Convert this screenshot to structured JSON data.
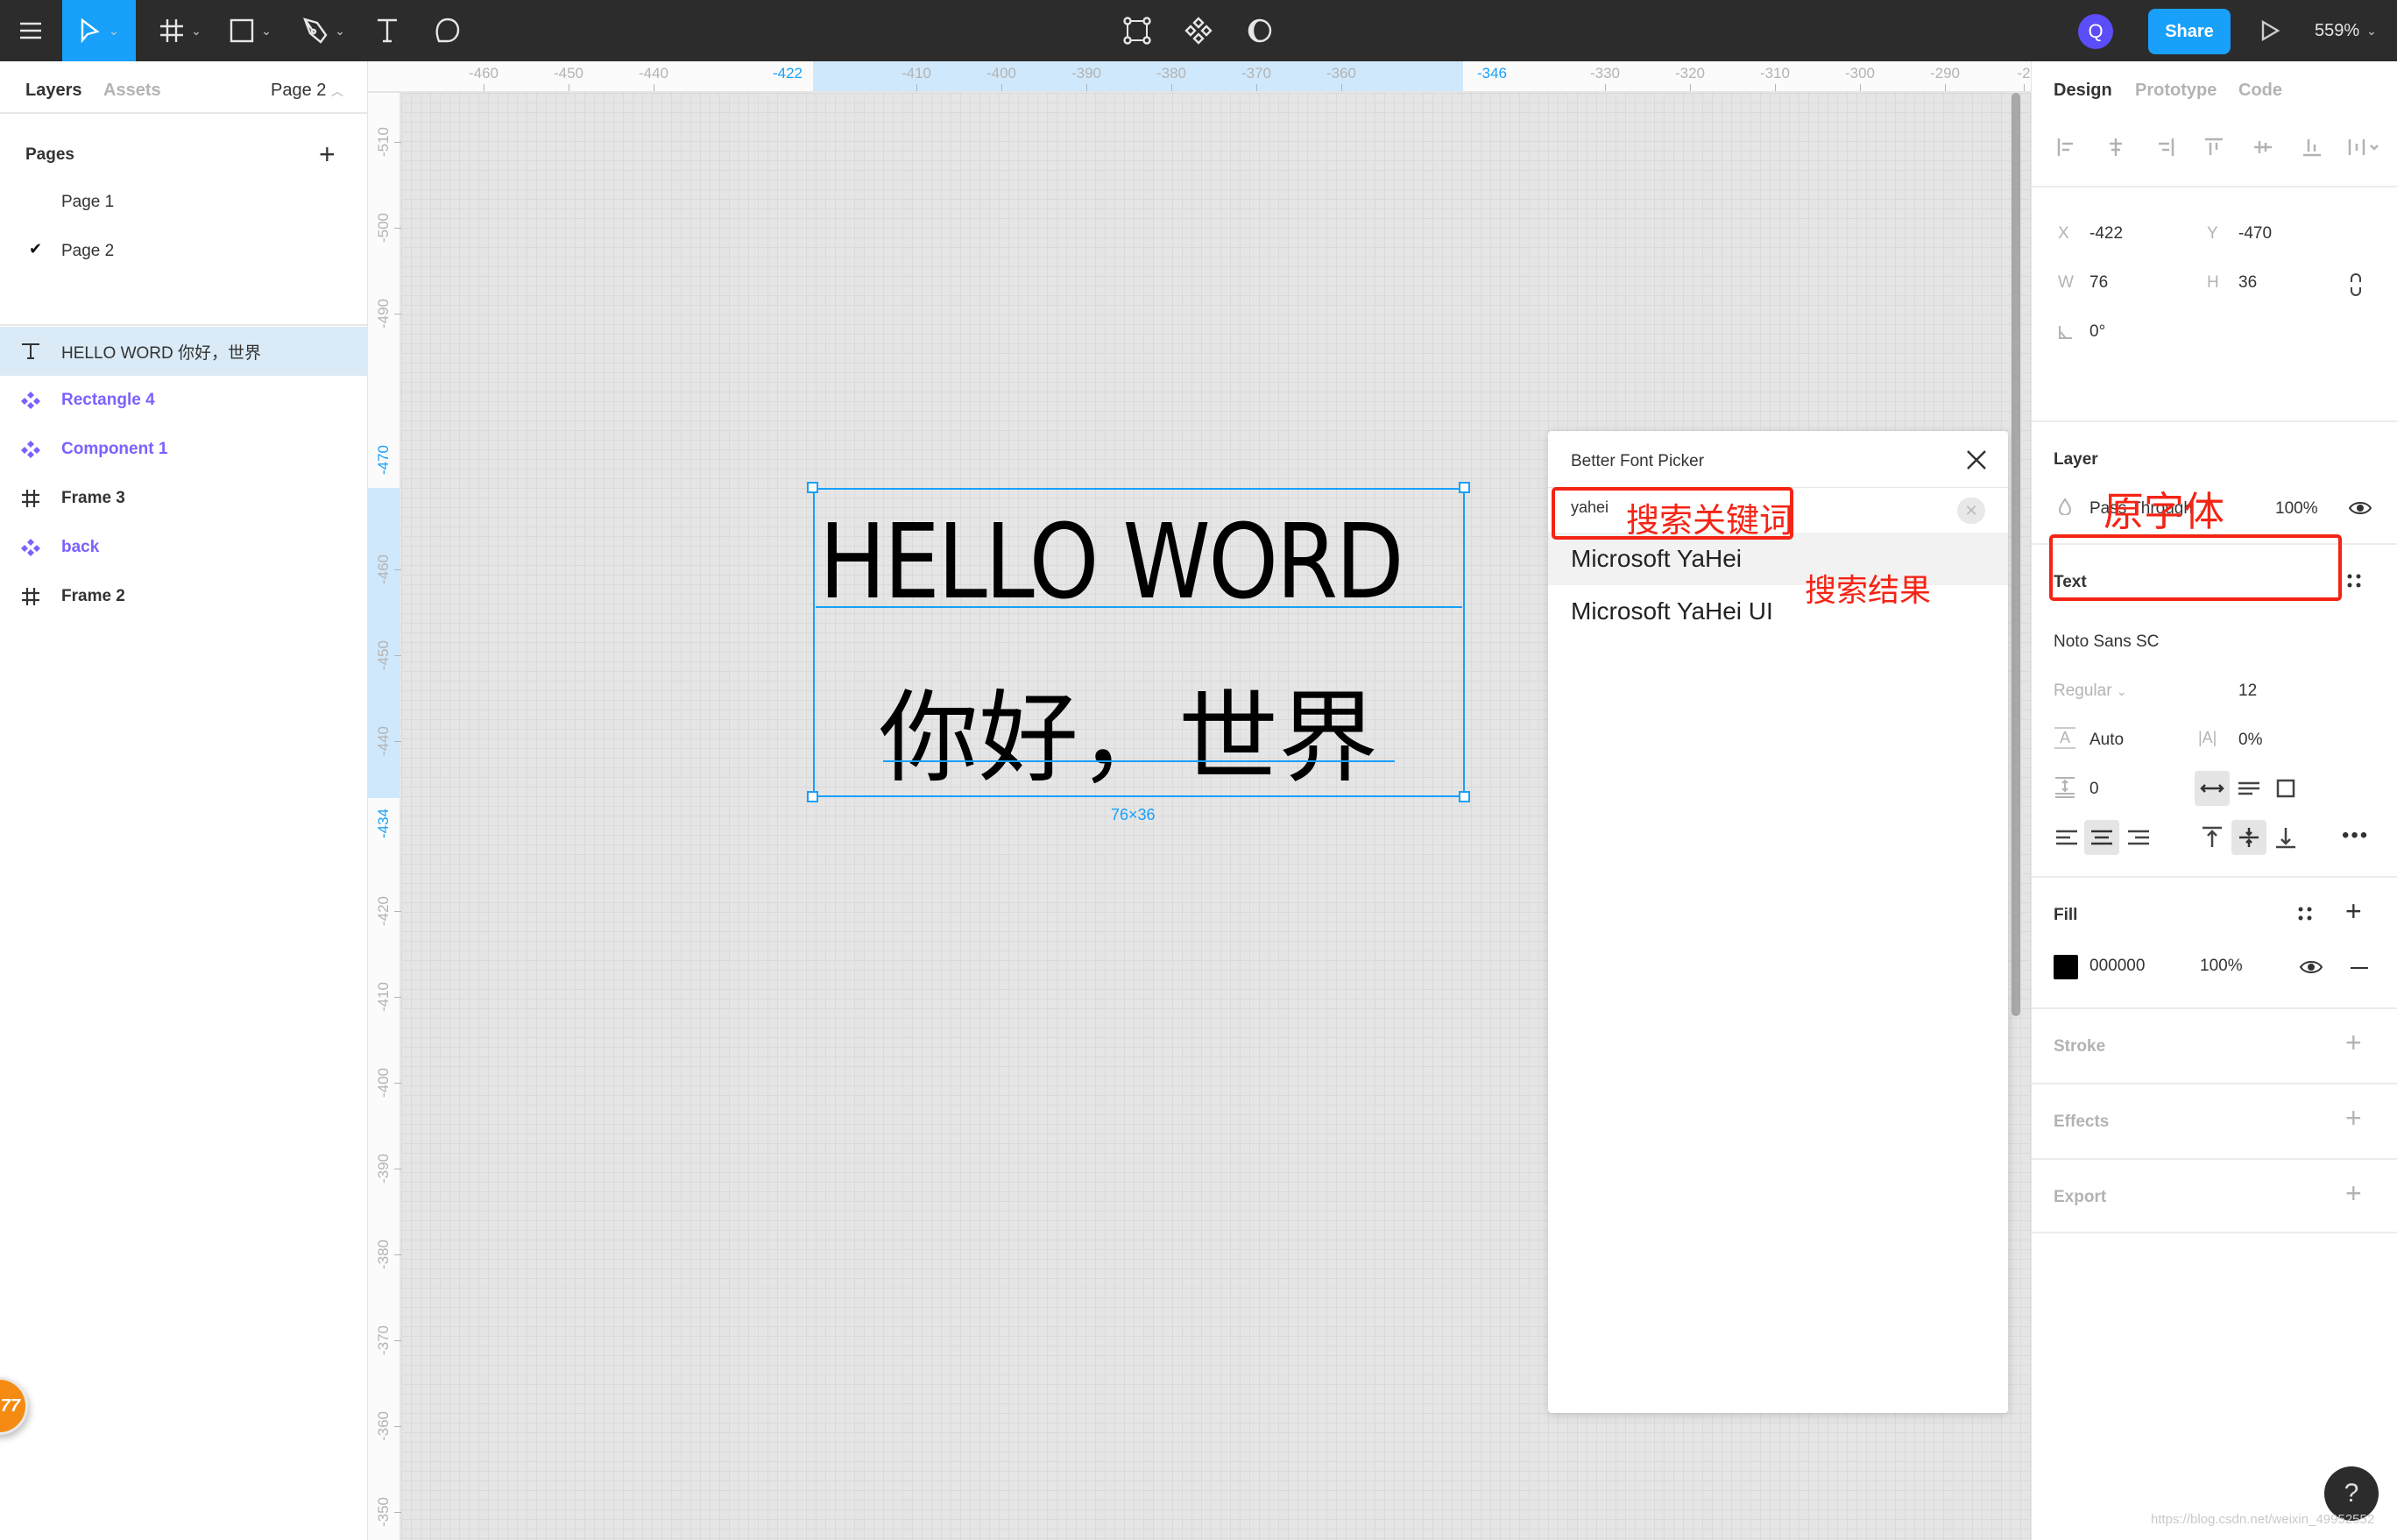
{
  "toolbar": {
    "menu_icon": "hamburger-menu-icon",
    "tools": [
      {
        "name": "move",
        "icon": "cursor-icon",
        "active": true
      },
      {
        "name": "frame",
        "icon": "frame-hash-icon"
      },
      {
        "name": "shape",
        "icon": "rectangle-icon"
      },
      {
        "name": "pen",
        "icon": "pen-icon"
      },
      {
        "name": "text",
        "icon": "text-icon"
      },
      {
        "name": "comment",
        "icon": "comment-icon"
      }
    ],
    "center_tools": [
      "edit-object-icon",
      "component-icon",
      "mask-contrast-icon"
    ],
    "avatar_initial": "Q",
    "avatar_color": "#5b4dfa",
    "share_label": "Share",
    "present_icon": "play-icon",
    "zoom_level": "559%",
    "accent_color": "#18a0fb"
  },
  "left_panel": {
    "tabs": {
      "layers": "Layers",
      "assets": "Assets"
    },
    "current_page": "Page 2",
    "pages_header": "Pages",
    "pages": [
      {
        "label": "Page 1",
        "checked": false
      },
      {
        "label": "Page 2",
        "checked": true
      }
    ],
    "layers": [
      {
        "label": "HELLO WORD 你好，世界",
        "type": "text",
        "selected": true
      },
      {
        "label": "Rectangle 4",
        "type": "component"
      },
      {
        "label": "Component 1",
        "type": "component"
      },
      {
        "label": "Frame 3",
        "type": "frame"
      },
      {
        "label": "back",
        "type": "component"
      },
      {
        "label": "Frame 2",
        "type": "frame"
      }
    ],
    "component_color": "#7b61ff"
  },
  "rulers": {
    "top": [
      "-460",
      "-450",
      "-440",
      "-422",
      "-410",
      "-400",
      "-390",
      "-380",
      "-370",
      "-360",
      "-346",
      "-330",
      "-320",
      "-310",
      "-300",
      "-290",
      "-2"
    ],
    "top_highlight": [
      "-422",
      "-346"
    ],
    "left": [
      "-510",
      "-500",
      "-490",
      "-470",
      "-460",
      "-450",
      "-440",
      "-434",
      "-420",
      "-410",
      "-400",
      "-390",
      "-380",
      "-370",
      "-360",
      "-350"
    ],
    "left_highlight": [
      "-470",
      "-434"
    ]
  },
  "canvas": {
    "text_line1": "HELLO WORD",
    "text_line2": "你好，世界",
    "dimensions": "76×36"
  },
  "font_picker": {
    "title": "Better Font Picker",
    "search_value": "yahei",
    "results": [
      "Microsoft YaHei",
      "Microsoft YaHei UI"
    ],
    "annotation_search": "搜索关键词",
    "annotation_results": "搜索结果"
  },
  "right_panel": {
    "tabs": {
      "design": "Design",
      "prototype": "Prototype",
      "code": "Code"
    },
    "position": {
      "x_label": "X",
      "x": "-422",
      "y_label": "Y",
      "y": "-470",
      "w_label": "W",
      "w": "76",
      "h_label": "H",
      "h": "36",
      "rotation": "0°"
    },
    "layer": {
      "title": "Layer",
      "blend": "Pass Through",
      "opacity": "100%"
    },
    "text": {
      "title": "Text",
      "annotation": "原字体",
      "font_family": "Noto Sans SC",
      "font_style": "Regular",
      "font_size": "12",
      "line_height": "Auto",
      "letter_spacing": "0%",
      "paragraph_spacing": "0"
    },
    "fill": {
      "title": "Fill",
      "hex": "000000",
      "opacity": "100%",
      "swatch": "#000000"
    },
    "stroke": {
      "title": "Stroke"
    },
    "effects": {
      "title": "Effects"
    },
    "export": {
      "title": "Export"
    }
  },
  "help_label": "?",
  "notification_badge": "77",
  "watermark": "https://blog.csdn.net/weixin_49952552"
}
